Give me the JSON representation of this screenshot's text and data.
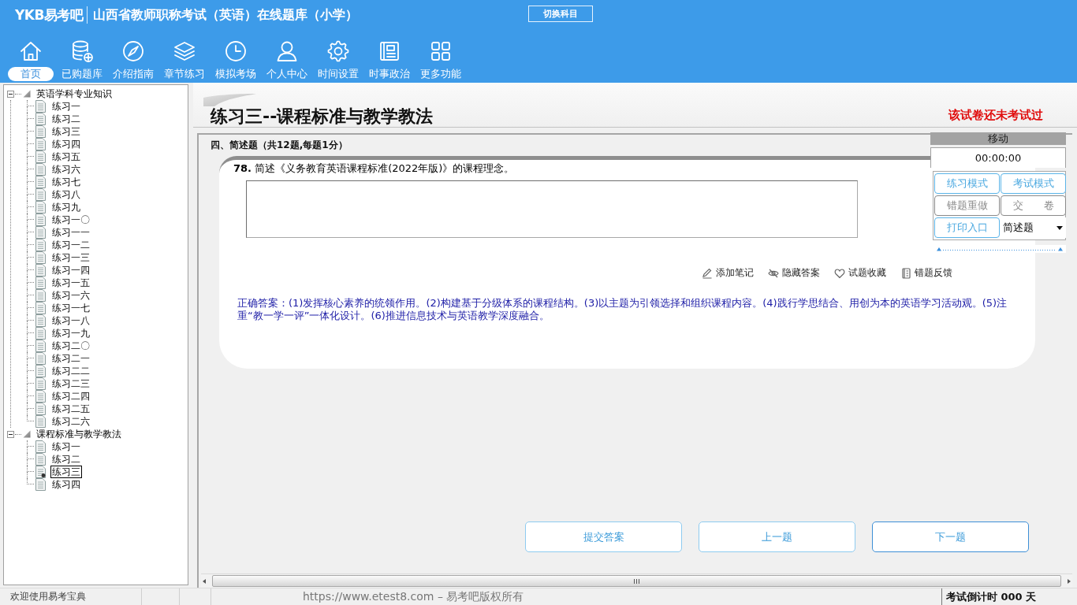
{
  "header": {
    "logo": "YKB易考吧",
    "title": "山西省教师职称考试（英语）在线题库（小学）",
    "switch_button": "切换科目"
  },
  "toolbar": [
    {
      "label": "首页",
      "selected": true
    },
    {
      "label": "已购题库",
      "selected": false
    },
    {
      "label": "介绍指南",
      "selected": false
    },
    {
      "label": "章节练习",
      "selected": false
    },
    {
      "label": "模拟考场",
      "selected": false
    },
    {
      "label": "个人中心",
      "selected": false
    },
    {
      "label": "时间设置",
      "selected": false
    },
    {
      "label": "时事政治",
      "selected": false
    },
    {
      "label": "更多功能",
      "selected": false
    }
  ],
  "tree": [
    {
      "label": "英语学科专业知识",
      "expanded": true,
      "children": [
        {
          "label": "练习一",
          "selected": false
        },
        {
          "label": "练习二",
          "selected": false
        },
        {
          "label": "练习三",
          "selected": false
        },
        {
          "label": "练习四",
          "selected": false
        },
        {
          "label": "练习五",
          "selected": false
        },
        {
          "label": "练习六",
          "selected": false
        },
        {
          "label": "练习七",
          "selected": false
        },
        {
          "label": "练习八",
          "selected": false
        },
        {
          "label": "练习九",
          "selected": false
        },
        {
          "label": "练习一〇",
          "selected": false
        },
        {
          "label": "练习一一",
          "selected": false
        },
        {
          "label": "练习一二",
          "selected": false
        },
        {
          "label": "练习一三",
          "selected": false
        },
        {
          "label": "练习一四",
          "selected": false
        },
        {
          "label": "练习一五",
          "selected": false
        },
        {
          "label": "练习一六",
          "selected": false
        },
        {
          "label": "练习一七",
          "selected": false
        },
        {
          "label": "练习一八",
          "selected": false
        },
        {
          "label": "练习一九",
          "selected": false
        },
        {
          "label": "练习二〇",
          "selected": false
        },
        {
          "label": "练习二一",
          "selected": false
        },
        {
          "label": "练习二二",
          "selected": false
        },
        {
          "label": "练习二三",
          "selected": false
        },
        {
          "label": "练习二四",
          "selected": false
        },
        {
          "label": "练习二五",
          "selected": false
        },
        {
          "label": "练习二六",
          "selected": false
        }
      ]
    },
    {
      "label": "课程标准与教学教法",
      "expanded": true,
      "children": [
        {
          "label": "练习一",
          "selected": false
        },
        {
          "label": "练习二",
          "selected": false
        },
        {
          "label": "练习三",
          "selected": true
        },
        {
          "label": "练习四",
          "selected": false
        }
      ]
    }
  ],
  "exam": {
    "title": "练习三--课程标准与教学教法",
    "status": "该试卷还未考试过",
    "section": "四、简述题（共12题,每题1分）",
    "question": "**78.** 简述《义务教育英语课程标准(2022年版)》的课程理念。",
    "actions": [
      "添加笔记",
      "隐藏答案",
      "试题收藏",
      "错题反馈"
    ],
    "answer": "正确答案：(1)发挥核心素养的统领作用。(2)构建基于分级体系的课程结构。(3)以主题为引领选择和组织课程内容。(4)践行学思结合、用创为本的英语学习活动观。(5)注重“教一学一评”一体化设计。(6)推进信息技术与英语教学深度融合。",
    "nav_buttons": [
      {
        "label": "提交答案",
        "focused": false
      },
      {
        "label": "上一题",
        "focused": false
      },
      {
        "label": "下一题",
        "focused": true
      }
    ]
  },
  "float_panel": {
    "handle": "移动",
    "timer": "00:00:00",
    "buttons": [
      {
        "label": "练习模式",
        "disabled": false
      },
      {
        "label": "考试模式",
        "disabled": false
      },
      {
        "label": "错题重做",
        "disabled": true
      },
      {
        "label": "交　　卷",
        "disabled": true
      },
      {
        "label": "打印入口",
        "disabled": false
      }
    ],
    "dropdown": {
      "value": "简述题"
    }
  },
  "status_bar": {
    "welcome": "欢迎使用易考宝典",
    "copyright": "https://www.etest8.com – 易考吧版权所有",
    "countdown": "考试倒计时 000 天"
  }
}
